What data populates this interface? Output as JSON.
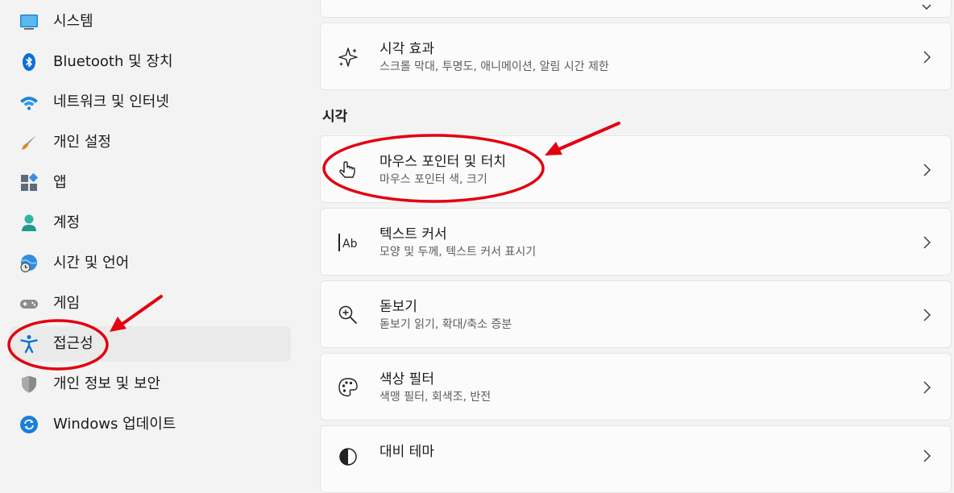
{
  "sidebar": {
    "items": [
      {
        "label": "시스템",
        "icon": "monitor-icon"
      },
      {
        "label": "Bluetooth 및 장치",
        "icon": "bluetooth-icon"
      },
      {
        "label": "네트워크 및 인터넷",
        "icon": "wifi-icon"
      },
      {
        "label": "개인 설정",
        "icon": "paintbrush-icon"
      },
      {
        "label": "앱",
        "icon": "apps-icon"
      },
      {
        "label": "계정",
        "icon": "person-icon"
      },
      {
        "label": "시간 및 언어",
        "icon": "globe-clock-icon"
      },
      {
        "label": "게임",
        "icon": "gamepad-icon"
      },
      {
        "label": "접근성",
        "icon": "accessibility-icon",
        "selected": true
      },
      {
        "label": "개인 정보 및 보안",
        "icon": "shield-icon"
      },
      {
        "label": "Windows 업데이트",
        "icon": "update-icon"
      }
    ]
  },
  "main": {
    "cards_top": [
      {
        "title": "시각 효과",
        "subtitle": "스크롤 막대, 투명도, 애니메이션, 알림 시간 제한",
        "icon": "sparkle-icon"
      }
    ],
    "section_title": "시각",
    "cards": [
      {
        "title": "마우스 포인터 및 터치",
        "subtitle": "마우스 포인터 색, 크기",
        "icon": "pointer-hand-icon"
      },
      {
        "title": "텍스트 커서",
        "subtitle": "모양 및 두께, 텍스트 커서 표시기",
        "icon": "text-cursor-icon"
      },
      {
        "title": "돋보기",
        "subtitle": "돋보기 읽기, 확대/축소 증분",
        "icon": "magnifier-icon"
      },
      {
        "title": "색상 필터",
        "subtitle": "색맹 필터, 회색조, 반전",
        "icon": "palette-icon"
      },
      {
        "title": "대비 테마",
        "subtitle": "",
        "icon": "contrast-icon"
      }
    ]
  },
  "colors": {
    "accent": "#0067c0",
    "annotation_red": "#e3000f",
    "background": "#f3f3f3",
    "card": "#fbfbfb"
  }
}
